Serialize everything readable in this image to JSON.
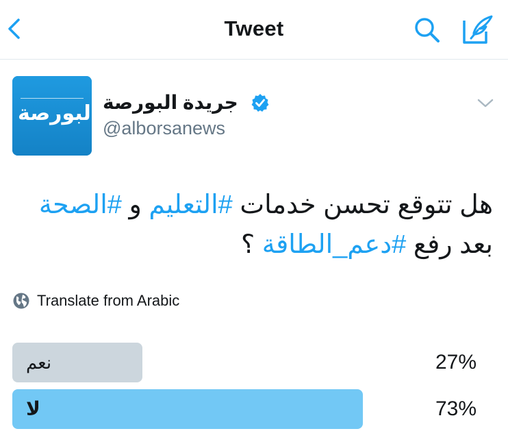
{
  "nav": {
    "title": "Tweet",
    "back_icon": "chevron-left-icon",
    "search_icon": "search-icon",
    "compose_icon": "compose-tweet-icon",
    "accent_color": "#1da1f2"
  },
  "tweet": {
    "author": {
      "name": "جريدة البورصة",
      "handle": "@alborsanews",
      "verified": true,
      "avatar_text": "البورصة"
    },
    "text_parts": [
      {
        "text": "هل تتوقع تحسن خدمات ",
        "hashtag": false
      },
      {
        "text": "#التعليم",
        "hashtag": true
      },
      {
        "text": " و ",
        "hashtag": false
      },
      {
        "text": "#الصحة",
        "hashtag": true
      },
      {
        "text": " بعد رفع ",
        "hashtag": false
      },
      {
        "text": "#دعم_الطاقة",
        "hashtag": true
      },
      {
        "text": " ؟",
        "hashtag": false
      }
    ],
    "translate_label": "Translate from Arabic",
    "translate_icon": "globe-icon",
    "menu_icon": "chevron-down-icon"
  },
  "poll": {
    "options": [
      {
        "label": "نعم",
        "percent_text": "27%",
        "share": 0.27,
        "winner": false
      },
      {
        "label": "لا",
        "percent_text": "73%",
        "share": 0.73,
        "winner": true
      }
    ],
    "colors": {
      "loser": "#ccd6dd",
      "winner": "#72c8f5"
    }
  }
}
